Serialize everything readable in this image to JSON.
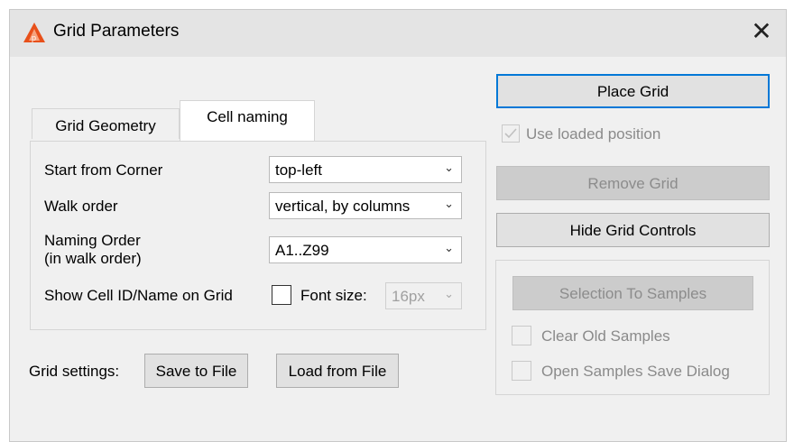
{
  "window": {
    "title": "Grid Parameters",
    "close_glyph": "✕",
    "app_icon": "warning-triangle-logo-icon"
  },
  "tabs": [
    {
      "label": "Grid Geometry",
      "selected": false
    },
    {
      "label": "Cell naming",
      "selected": true
    }
  ],
  "cell_naming": {
    "start_corner": {
      "label": "Start from Corner",
      "value": "top-left"
    },
    "walk_order": {
      "label": "Walk order",
      "value": "vertical, by columns"
    },
    "naming_order": {
      "label_line1": "Naming Order",
      "label_line2": "(in walk order)",
      "value": "A1..Z99"
    },
    "show_cell_id": {
      "label": "Show Cell ID/Name on Grid",
      "checked": false
    },
    "font_size": {
      "label": "Font size:",
      "value": "16px",
      "enabled": false
    }
  },
  "grid_settings": {
    "label": "Grid settings:",
    "save_label": "Save to File",
    "load_label": "Load from File"
  },
  "right_panel": {
    "place_grid": "Place Grid",
    "use_loaded_position": {
      "label": "Use loaded position",
      "checked": true,
      "enabled": false
    },
    "remove_grid": "Remove Grid",
    "hide_grid_controls": "Hide Grid Controls",
    "selection_to_samples": "Selection To Samples",
    "clear_old_samples": "Clear Old Samples",
    "open_samples_save_dialog": "Open Samples Save Dialog"
  },
  "colors": {
    "accent": "#0078d7",
    "icon_orange": "#e8501a",
    "dialog_bg": "#f0f0f0",
    "disabled_button": "#cccccc"
  }
}
